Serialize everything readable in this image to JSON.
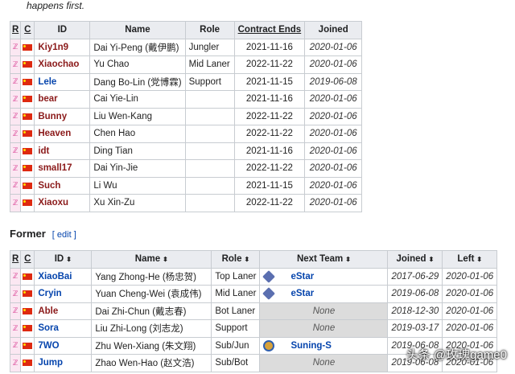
{
  "intro_text": "happens first.",
  "current_table": {
    "headers": {
      "r": "R",
      "c": "C",
      "id": "ID",
      "name": "Name",
      "role": "Role",
      "contract": "Contract Ends",
      "joined": "Joined"
    },
    "r_glyph": "ℤ",
    "rows": [
      {
        "id": "Kiy1n9",
        "name": "Dai Yi-Peng (戴伊鹏)",
        "role": "Jungler",
        "contract": "2021-11-16",
        "joined": "2020-01-06"
      },
      {
        "id": "Xiaochao",
        "name": "Yu Chao",
        "role": "Mid Laner",
        "contract": "2022-11-22",
        "joined": "2020-01-06"
      },
      {
        "id": "Lele",
        "name": "Dang Bo-Lin (党博霖)",
        "role": "Support",
        "contract": "2021-11-15",
        "joined": "2019-06-08"
      },
      {
        "id": "bear",
        "name": "Cai Yie-Lin",
        "role": "",
        "contract": "2021-11-16",
        "joined": "2020-01-06"
      },
      {
        "id": "Bunny",
        "name": "Liu Wen-Kang",
        "role": "",
        "contract": "2022-11-22",
        "joined": "2020-01-06"
      },
      {
        "id": "Heaven",
        "name": "Chen Hao",
        "role": "",
        "contract": "2022-11-22",
        "joined": "2020-01-06"
      },
      {
        "id": "idt",
        "name": "Ding Tian",
        "role": "",
        "contract": "2021-11-16",
        "joined": "2020-01-06"
      },
      {
        "id": "small17",
        "name": "Dai Yin-Jie",
        "role": "",
        "contract": "2022-11-22",
        "joined": "2020-01-06"
      },
      {
        "id": "Such",
        "name": "Li Wu",
        "role": "",
        "contract": "2021-11-15",
        "joined": "2020-01-06"
      },
      {
        "id": "Xiaoxu",
        "name": "Xu Xin-Zu",
        "role": "",
        "contract": "2022-11-22",
        "joined": "2020-01-06"
      }
    ]
  },
  "former_section": {
    "title": "Former",
    "edit": "[ edit ]"
  },
  "former_table": {
    "headers": {
      "r": "R",
      "c": "C",
      "id": "ID",
      "name": "Name",
      "role": "Role",
      "next_team": "Next Team",
      "joined": "Joined",
      "left": "Left"
    },
    "sort_glyph": "⬍",
    "rows": [
      {
        "id": "XiaoBai",
        "name": "Yang Zhong-He (杨忠贺)",
        "role": "Top Laner",
        "next_team": "eStar",
        "team_logo": "estar-logo",
        "joined": "2017-06-29",
        "left": "2020-01-06"
      },
      {
        "id": "Cryin",
        "name": "Yuan Cheng-Wei (袁成伟)",
        "role": "Mid Laner",
        "next_team": "eStar",
        "team_logo": "estar-logo",
        "joined": "2019-06-08",
        "left": "2020-01-06"
      },
      {
        "id": "Able",
        "name": "Dai Zhi-Chun (戴志春)",
        "role": "Bot Laner",
        "next_team": "None",
        "team_logo": "",
        "joined": "2018-12-30",
        "left": "2020-01-06"
      },
      {
        "id": "Sora",
        "name": "Liu Zhi-Long (刘志龙)",
        "role": "Support",
        "next_team": "None",
        "team_logo": "",
        "joined": "2019-03-17",
        "left": "2020-01-06"
      },
      {
        "id": "7WO",
        "name": "Zhu Wen-Xiang (朱文翔)",
        "role": "Sub/Jun",
        "next_team": "Suning-S",
        "team_logo": "suning-logo",
        "joined": "2019-06-08",
        "left": "2020-01-06"
      },
      {
        "id": "Jump",
        "name": "Zhao Wen-Hao (赵文浩)",
        "role": "Sub/Bot",
        "next_team": "None",
        "team_logo": "",
        "joined": "2019-06-08",
        "left": "2020-01-06"
      }
    ]
  },
  "watermark": "头条 @玫瑰game0"
}
